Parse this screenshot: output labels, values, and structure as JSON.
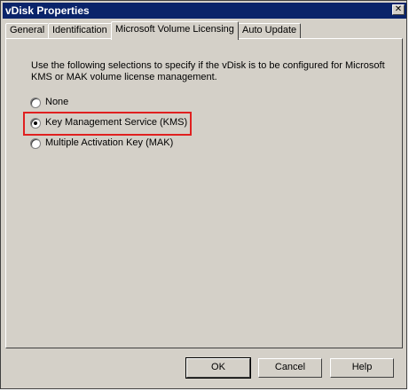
{
  "window": {
    "title": "vDisk Properties",
    "close_glyph": "✕"
  },
  "tabs": [
    {
      "label": "General",
      "active": false
    },
    {
      "label": "Identification",
      "active": false
    },
    {
      "label": "Microsoft Volume Licensing",
      "active": true
    },
    {
      "label": "Auto Update",
      "active": false
    }
  ],
  "panel": {
    "description": "Use the following selections to specify if the vDisk is to be configured for Microsoft KMS or MAK volume license management.",
    "options": [
      {
        "label": "None",
        "checked": false
      },
      {
        "label": "Key Management Service (KMS)",
        "checked": true
      },
      {
        "label": "Multiple Activation Key (MAK)",
        "checked": false
      }
    ],
    "highlight_color": "#e02020"
  },
  "buttons": {
    "ok": "OK",
    "cancel": "Cancel",
    "help": "Help"
  }
}
